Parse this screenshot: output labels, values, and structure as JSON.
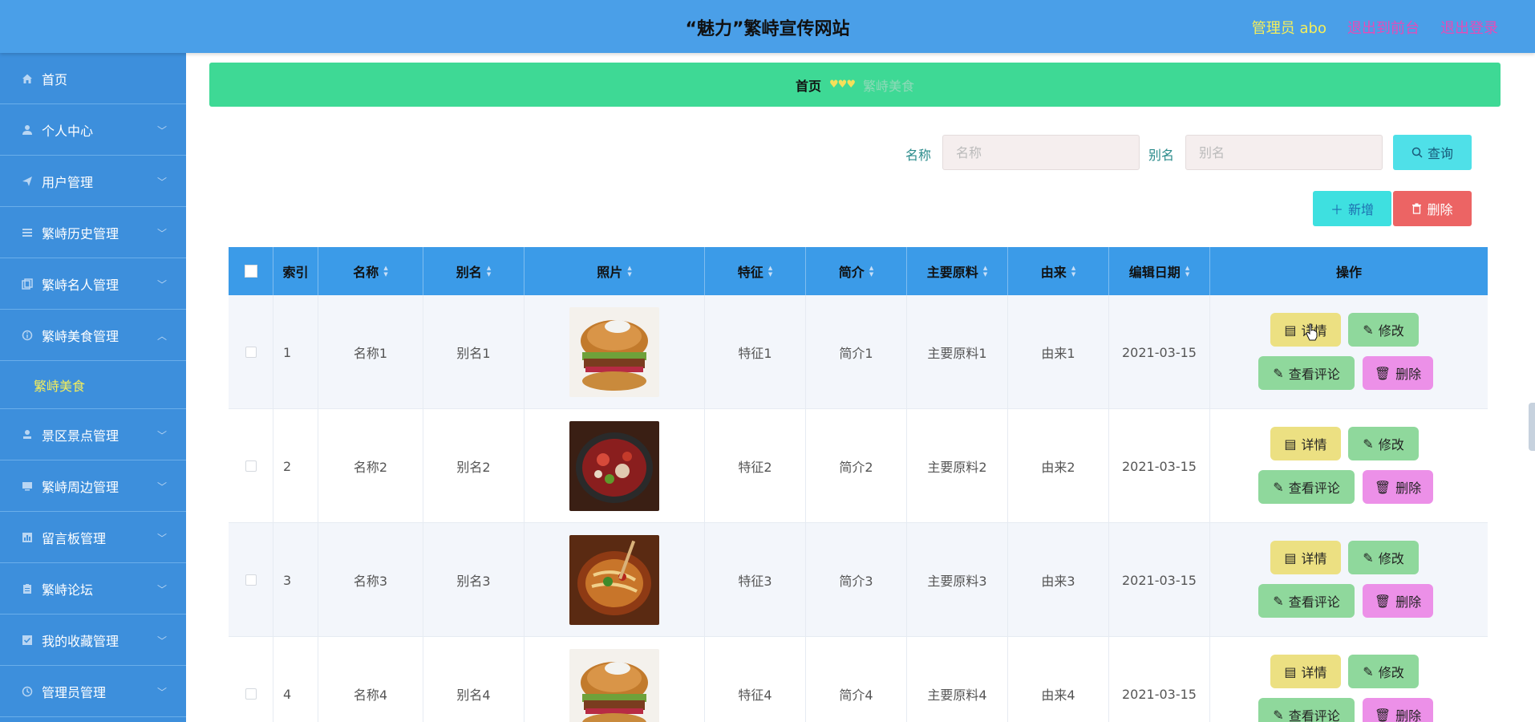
{
  "header": {
    "title": "“魅力”繁峙宣传网站",
    "admin": "管理员 abo",
    "front_link": "退出到前台",
    "logout_link": "退出登录"
  },
  "sidebar": {
    "items": [
      {
        "label": "首页",
        "icon": "home-icon"
      },
      {
        "label": "个人中心",
        "icon": "user-icon"
      },
      {
        "label": "用户管理",
        "icon": "send-icon"
      },
      {
        "label": "繁峙历史管理",
        "icon": "list-icon"
      },
      {
        "label": "繁峙名人管理",
        "icon": "copy-icon"
      },
      {
        "label": "繁峙美食管理",
        "icon": "info-icon"
      },
      {
        "label": "景区景点管理",
        "icon": "stamp-icon"
      },
      {
        "label": "繁峙周边管理",
        "icon": "monitor-icon"
      },
      {
        "label": "留言板管理",
        "icon": "chart-icon"
      },
      {
        "label": "繁峙论坛",
        "icon": "clipboard-icon"
      },
      {
        "label": "我的收藏管理",
        "icon": "check-icon"
      },
      {
        "label": "管理员管理",
        "icon": "clock-icon"
      }
    ],
    "active_sub": "繁峙美食"
  },
  "breadcrumb": {
    "home": "首页",
    "separator": "♥♥♥",
    "current": "繁峙美食"
  },
  "search": {
    "name_label": "名称",
    "name_placeholder": "名称",
    "alias_label": "别名",
    "alias_placeholder": "别名",
    "query_button": "查询"
  },
  "actions": {
    "add": "新增",
    "delete": "删除"
  },
  "table": {
    "columns": [
      "索引",
      "名称",
      "别名",
      "照片",
      "特征",
      "简介",
      "主要原料",
      "由来",
      "编辑日期",
      "操作"
    ],
    "rows": [
      {
        "index": "1",
        "name": "名称1",
        "alias": "别名1",
        "feature": "特征1",
        "intro": "简介1",
        "ingredient": "主要原料1",
        "origin": "由来1",
        "date": "2021-03-15",
        "photo": "burger"
      },
      {
        "index": "2",
        "name": "名称2",
        "alias": "别名2",
        "feature": "特征2",
        "intro": "简介2",
        "ingredient": "主要原料2",
        "origin": "由来2",
        "date": "2021-03-15",
        "photo": "hotpot"
      },
      {
        "index": "3",
        "name": "名称3",
        "alias": "别名3",
        "feature": "特征3",
        "intro": "简介3",
        "ingredient": "主要原料3",
        "origin": "由来3",
        "date": "2021-03-15",
        "photo": "noodles"
      },
      {
        "index": "4",
        "name": "名称4",
        "alias": "别名4",
        "feature": "特征4",
        "intro": "简介4",
        "ingredient": "主要原料4",
        "origin": "由来4",
        "date": "2021-03-15",
        "photo": "burger"
      }
    ],
    "ops": {
      "detail": "详情",
      "edit": "修改",
      "comments": "查看评论",
      "delete": "删除"
    }
  },
  "colors": {
    "header": "#4a9fe8",
    "sidebar": "#3d8fdc",
    "breadcrumb": "#3ed995",
    "table_header": "#3b9be8"
  }
}
